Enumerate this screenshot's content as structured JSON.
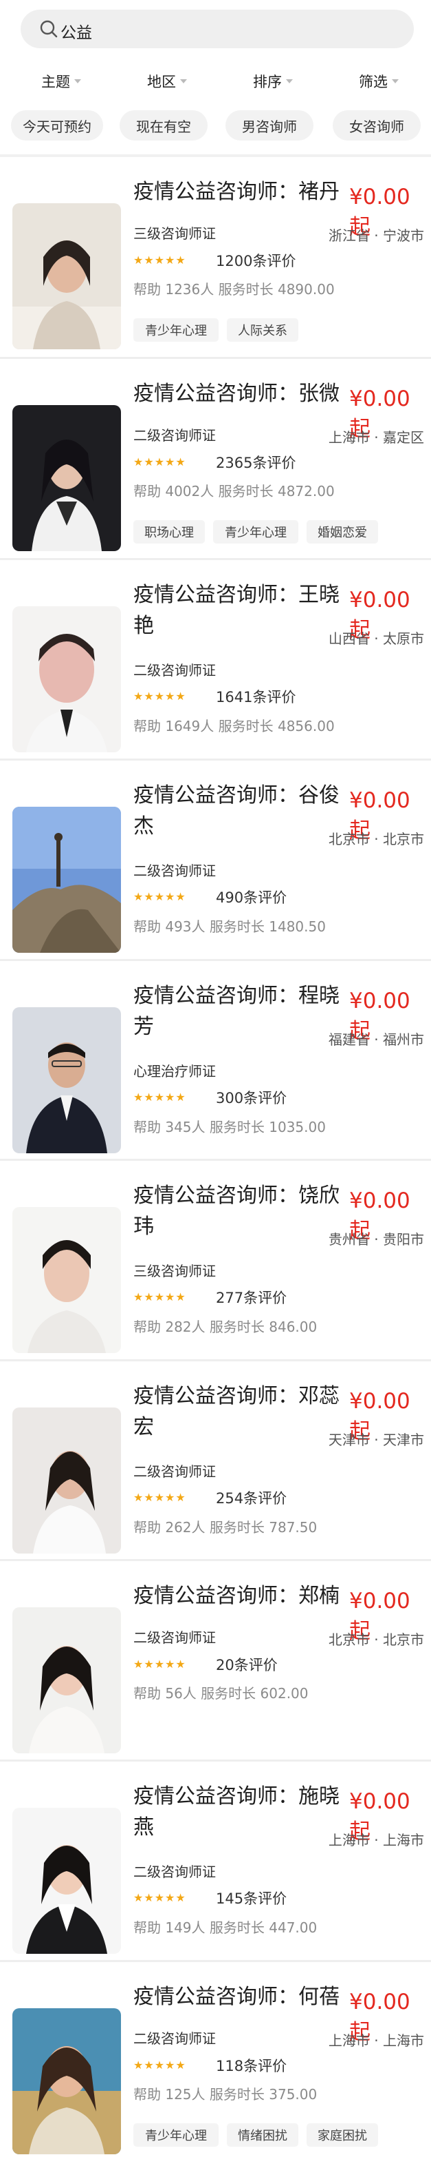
{
  "search": {
    "value": "公益"
  },
  "filters": [
    "主题",
    "地区",
    "排序",
    "筛选"
  ],
  "quick_filters": [
    "今天可预约",
    "现在有空",
    "男咨询师",
    "女咨询师"
  ],
  "counselors": [
    {
      "name": "疫情公益咨询师：褚丹",
      "price": "¥0.00起",
      "region": "浙江省 · 宁波市",
      "cert": "三级咨询师证",
      "rating": 5,
      "reviews": "1200条评价",
      "helped": "帮助 1236人",
      "duration": "服务时长 4890.00",
      "tags": [
        "青少年心理",
        "人际关系"
      ]
    },
    {
      "name": "疫情公益咨询师：张微",
      "price": "¥0.00起",
      "region": "上海市 · 嘉定区",
      "cert": "二级咨询师证",
      "rating": 5,
      "reviews": "2365条评价",
      "helped": "帮助 4002人",
      "duration": "服务时长 4872.00",
      "tags": [
        "职场心理",
        "青少年心理",
        "婚姻恋爱"
      ]
    },
    {
      "name": "疫情公益咨询师：王晓艳",
      "price": "¥0.00起",
      "region": "山西省 · 太原市",
      "cert": "二级咨询师证",
      "rating": 5,
      "reviews": "1641条评价",
      "helped": "帮助 1649人",
      "duration": "服务时长 4856.00",
      "tags": []
    },
    {
      "name": "疫情公益咨询师：谷俊杰",
      "price": "¥0.00起",
      "region": "北京市 · 北京市",
      "cert": "二级咨询师证",
      "rating": 5,
      "reviews": "490条评价",
      "helped": "帮助 493人",
      "duration": "服务时长 1480.50",
      "tags": []
    },
    {
      "name": "疫情公益咨询师：程晓芳",
      "price": "¥0.00起",
      "region": "福建省 · 福州市",
      "cert": "心理治疗师证",
      "rating": 5,
      "reviews": "300条评价",
      "helped": "帮助 345人",
      "duration": "服务时长 1035.00",
      "tags": []
    },
    {
      "name": "疫情公益咨询师：饶欣玮",
      "price": "¥0.00起",
      "region": "贵州省 · 贵阳市",
      "cert": "三级咨询师证",
      "rating": 5,
      "reviews": "277条评价",
      "helped": "帮助 282人",
      "duration": "服务时长 846.00",
      "tags": []
    },
    {
      "name": "疫情公益咨询师：邓蕊宏",
      "price": "¥0.00起",
      "region": "天津市 · 天津市",
      "cert": "二级咨询师证",
      "rating": 5,
      "reviews": "254条评价",
      "helped": "帮助 262人",
      "duration": "服务时长 787.50",
      "tags": []
    },
    {
      "name": "疫情公益咨询师：郑楠",
      "price": "¥0.00起",
      "region": "北京市 · 北京市",
      "cert": "二级咨询师证",
      "rating": 5,
      "reviews": "20条评价",
      "helped": "帮助 56人",
      "duration": "服务时长 602.00",
      "tags": []
    },
    {
      "name": "疫情公益咨询师：施晓燕",
      "price": "¥0.00起",
      "region": "上海市 · 上海市",
      "cert": "二级咨询师证",
      "rating": 5,
      "reviews": "145条评价",
      "helped": "帮助 149人",
      "duration": "服务时长 447.00",
      "tags": []
    },
    {
      "name": "疫情公益咨询师：何蓓",
      "price": "¥0.00起",
      "region": "上海市 · 上海市",
      "cert": "二级咨询师证",
      "rating": 5,
      "reviews": "118条评价",
      "helped": "帮助 125人",
      "duration": "服务时长 375.00",
      "tags": [
        "青少年心理",
        "情绪困扰",
        "家庭困扰"
      ]
    }
  ],
  "colors": {
    "price": "#e4281f",
    "star": "#f3a816",
    "chip_bg": "#f2f2f2",
    "tag_bg": "#f4f4f4"
  }
}
